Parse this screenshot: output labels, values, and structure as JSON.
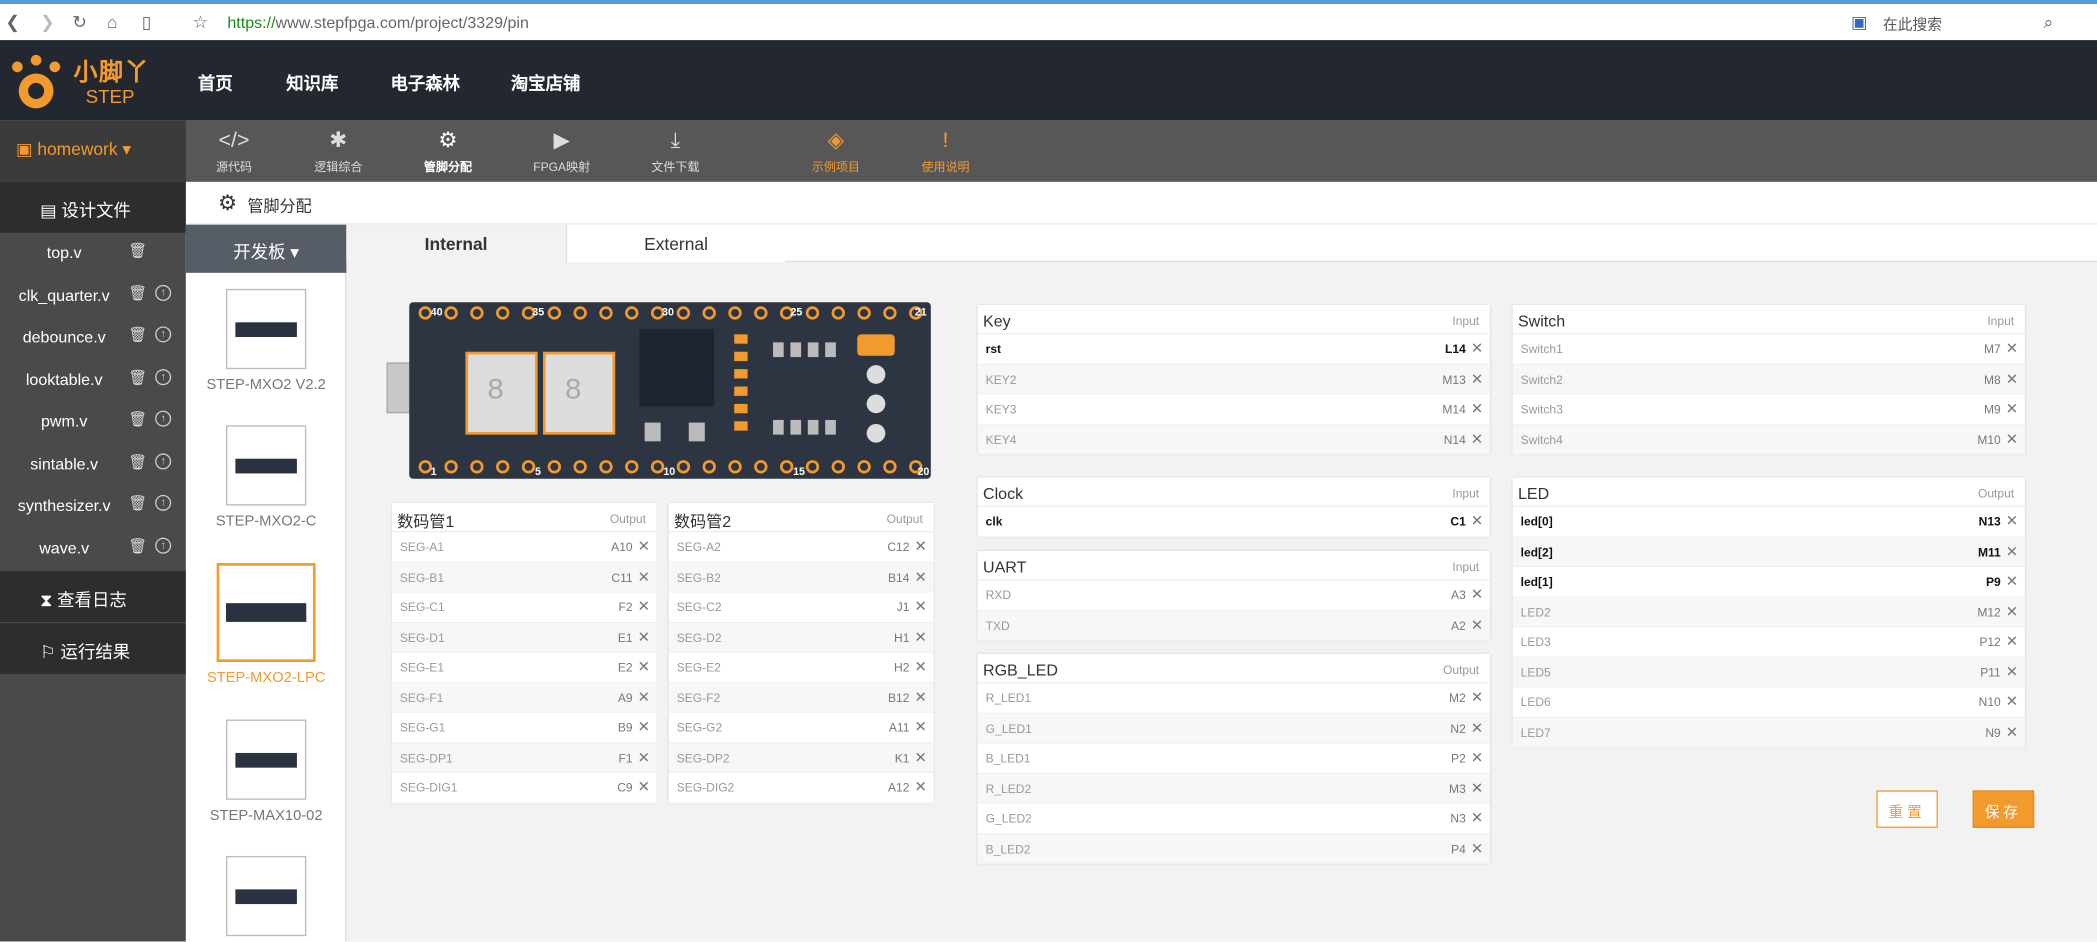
{
  "browser": {
    "url_scheme": "https://",
    "url_rest": "www.stepfpga.com/project/3329/pin",
    "search_placeholder": "在此搜索"
  },
  "brand": {
    "name_cn": "小脚丫",
    "name_en": "STEP"
  },
  "nav": [
    "首页",
    "知识库",
    "电子森林",
    "淘宝店铺"
  ],
  "project": "homework",
  "tools": [
    {
      "label": "源代码",
      "icon": "</>"
    },
    {
      "label": "逻辑综合",
      "icon": "✱"
    },
    {
      "label": "管脚分配",
      "icon": "⚙"
    },
    {
      "label": "FPGA映射",
      "icon": "▶"
    },
    {
      "label": "文件下载",
      "icon": "⤓"
    },
    {
      "label": "示例项目",
      "icon": "◈"
    },
    {
      "label": "使用说明",
      "icon": "!"
    }
  ],
  "sidebar": {
    "design_files": "设计文件",
    "files": [
      "top.v",
      "clk_quarter.v",
      "debounce.v",
      "looktable.v",
      "pwm.v",
      "sintable.v",
      "synthesizer.v",
      "wave.v"
    ],
    "log": "查看日志",
    "result": "运行结果"
  },
  "page_title": "管脚分配",
  "boards_header": "开发板",
  "boards": [
    "STEP-MXO2 V2.2",
    "STEP-MXO2-C",
    "STEP-MXO2-LPC",
    "STEP-MAX10-02"
  ],
  "tabs": [
    "Internal",
    "External"
  ],
  "board_pins": {
    "top": [
      "40",
      "35",
      "30",
      "25",
      "21"
    ],
    "bottom": [
      "1",
      "5",
      "10",
      "15",
      "20"
    ]
  },
  "panels": {
    "seg1": {
      "title": "数码管1",
      "dir": "Output",
      "rows": [
        [
          "SEG-A1",
          "A10"
        ],
        [
          "SEG-B1",
          "C11"
        ],
        [
          "SEG-C1",
          "F2"
        ],
        [
          "SEG-D1",
          "E1"
        ],
        [
          "SEG-E1",
          "E2"
        ],
        [
          "SEG-F1",
          "A9"
        ],
        [
          "SEG-G1",
          "B9"
        ],
        [
          "SEG-DP1",
          "F1"
        ],
        [
          "SEG-DIG1",
          "C9"
        ]
      ]
    },
    "seg2": {
      "title": "数码管2",
      "dir": "Output",
      "rows": [
        [
          "SEG-A2",
          "C12"
        ],
        [
          "SEG-B2",
          "B14"
        ],
        [
          "SEG-C2",
          "J1"
        ],
        [
          "SEG-D2",
          "H1"
        ],
        [
          "SEG-E2",
          "H2"
        ],
        [
          "SEG-F2",
          "B12"
        ],
        [
          "SEG-G2",
          "A11"
        ],
        [
          "SEG-DP2",
          "K1"
        ],
        [
          "SEG-DIG2",
          "A12"
        ]
      ]
    },
    "key": {
      "title": "Key",
      "dir": "Input",
      "rows": [
        [
          "rst",
          "L14"
        ],
        [
          "KEY2",
          "M13"
        ],
        [
          "KEY3",
          "M14"
        ],
        [
          "KEY4",
          "N14"
        ]
      ]
    },
    "clock": {
      "title": "Clock",
      "dir": "Input",
      "rows": [
        [
          "clk",
          "C1"
        ]
      ]
    },
    "uart": {
      "title": "UART",
      "dir": "Input",
      "rows": [
        [
          "RXD",
          "A3"
        ],
        [
          "TXD",
          "A2"
        ]
      ]
    },
    "rgb": {
      "title": "RGB_LED",
      "dir": "Output",
      "rows": [
        [
          "R_LED1",
          "M2"
        ],
        [
          "G_LED1",
          "N2"
        ],
        [
          "B_LED1",
          "P2"
        ],
        [
          "R_LED2",
          "M3"
        ],
        [
          "G_LED2",
          "N3"
        ],
        [
          "B_LED2",
          "P4"
        ]
      ]
    },
    "switch": {
      "title": "Switch",
      "dir": "Input",
      "rows": [
        [
          "Switch1",
          "M7"
        ],
        [
          "Switch2",
          "M8"
        ],
        [
          "Switch3",
          "M9"
        ],
        [
          "Switch4",
          "M10"
        ]
      ]
    },
    "led": {
      "title": "LED",
      "dir": "Output",
      "rows": [
        [
          "led[0]",
          "N13"
        ],
        [
          "led[2]",
          "M11"
        ],
        [
          "led[1]",
          "P9"
        ],
        [
          "LED2",
          "M12"
        ],
        [
          "LED3",
          "P12"
        ],
        [
          "LED5",
          "P11"
        ],
        [
          "LED6",
          "N10"
        ],
        [
          "LED7",
          "N9"
        ]
      ]
    }
  },
  "assigned": {
    "key": [
      0
    ],
    "clock": [
      0
    ],
    "led": [
      0,
      1,
      2
    ]
  },
  "buttons": {
    "reset": "重置",
    "save": "保存"
  },
  "colors": {
    "accent": "#f39a2f",
    "topbar": "#232830"
  }
}
